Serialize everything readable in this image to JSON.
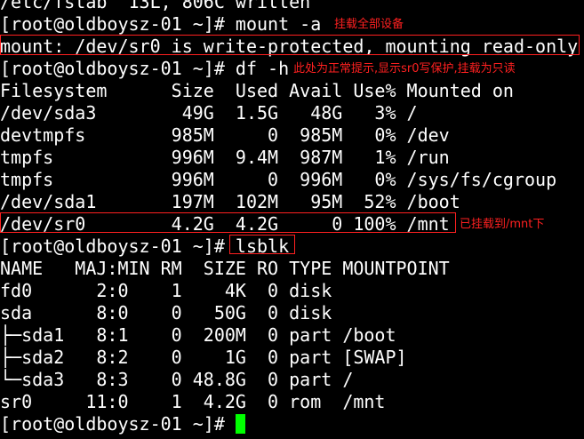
{
  "accent": "#ff2020",
  "cursor_color": "#00ff00",
  "lines": [
    {
      "text": "/etc/fstab' 13L, 806C written"
    },
    {
      "prompt": "[root@oldboysz-01 ~]# ",
      "command": "mount -a",
      "note": "挂载全部设备"
    },
    {
      "text": "mount: /dev/sr0 is write-protected, mounting read-only"
    },
    {
      "prompt": "[root@oldboysz-01 ~]# ",
      "command": "df -h",
      "note": "此处为正常提示,显示sr0写保护,挂载为只读"
    },
    {
      "text": "Filesystem      Size  Used Avail Use% Mounted on"
    },
    {
      "text": "/dev/sda3        49G  1.5G   48G   3% /"
    },
    {
      "text": "devtmpfs        985M     0  985M   0% /dev"
    },
    {
      "text": "tmpfs           996M  9.4M  987M   1% /run"
    },
    {
      "text": "tmpfs           996M     0  996M   0% /sys/fs/cgroup"
    },
    {
      "text": "/dev/sda1       197M  102M   95M  52% /boot"
    },
    {
      "text": "/dev/sr0        4.2G  4.2G     0 100% /mnt",
      "note": "已挂载到/mnt下"
    },
    {
      "prompt": "[root@oldboysz-01 ~]# ",
      "command": "lsblk"
    },
    {
      "text": "NAME   MAJ:MIN RM  SIZE RO TYPE MOUNTPOINT"
    },
    {
      "text": "fd0      2:0    1    4K  0 disk"
    },
    {
      "text": "sda      8:0    0   50G  0 disk"
    },
    {
      "text": "├─sda1   8:1    0  200M  0 part /boot"
    },
    {
      "text": "├─sda2   8:2    0    1G  0 part [SWAP]"
    },
    {
      "text": "└─sda3   8:3    0 48.8G  0 part /"
    },
    {
      "text": "sr0     11:0    1  4.2G  0 rom  /mnt"
    },
    {
      "prompt": "[root@oldboysz-01 ~]# ",
      "command": ""
    }
  ]
}
